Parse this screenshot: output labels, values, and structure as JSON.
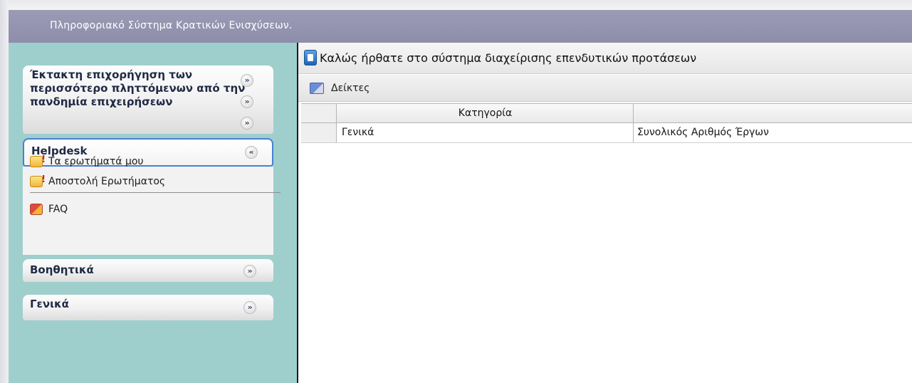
{
  "app": {
    "title": "Πληροφοριακό Σύστημα Κρατικών Ενισχύσεων."
  },
  "sidebar": {
    "panels": [
      {
        "title": "Έκτακτη επιχορήγηση των περισσότερο πληττόμενων από την πανδημία επιχειρήσεων",
        "state": "collapsed"
      },
      {
        "title": "Helpdesk",
        "state": "expanded",
        "items": [
          {
            "label": "Τα ερωτήματά μου",
            "icon": "question-folder-icon"
          },
          {
            "label": "Αποστολή Ερωτήματος",
            "icon": "question-folder-icon"
          },
          {
            "label": "FAQ",
            "icon": "faq-icon"
          }
        ]
      },
      {
        "title": "Βοηθητικά",
        "state": "collapsed"
      },
      {
        "title": "Γενικά",
        "state": "collapsed"
      }
    ]
  },
  "main": {
    "header_title": "Καλώς ήρθατε στο σύστημα διαχείρισης επενδυτικών προτάσεων",
    "toolbar_label": "Δείκτες",
    "grid": {
      "columns": [
        "Κατηγορία",
        ""
      ],
      "rows": [
        [
          "Γενικά",
          "Συνολικός Αριθμός Έργων"
        ]
      ]
    }
  },
  "colors": {
    "titlebar": "#9393b0",
    "sidebar": "#9ecfcd",
    "active_border": "#4a7fd0"
  }
}
